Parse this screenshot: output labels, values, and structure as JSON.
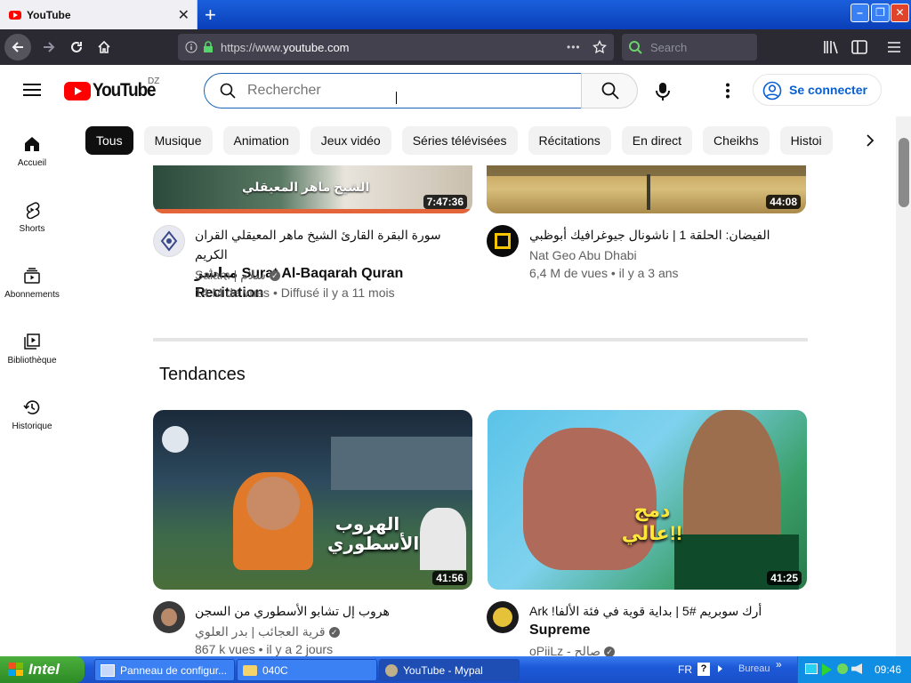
{
  "browser": {
    "tab_title": "YouTube",
    "tab_close": "✕",
    "new_tab": "+",
    "url_prefix": "https://www.",
    "url_host": "youtube.com",
    "url_more": "•••",
    "search_placeholder": "Search",
    "window_buttons": [
      "–",
      "❐",
      "✕"
    ]
  },
  "youtube": {
    "logo_text": "YouTube",
    "country_code": "DZ",
    "search_placeholder": "Rechercher",
    "signin_label": "Se connecter",
    "chips": [
      "Tous",
      "Musique",
      "Animation",
      "Jeux vidéo",
      "Séries télévisées",
      "Récitations",
      "En direct",
      "Cheikhs",
      "Histoi"
    ],
    "sidebar": [
      {
        "label": "Accueil",
        "icon": "home-icon"
      },
      {
        "label": "Shorts",
        "icon": "shorts-icon"
      },
      {
        "label": "Abonnements",
        "icon": "subscriptions-icon"
      },
      {
        "label": "Bibliothèque",
        "icon": "library-icon"
      },
      {
        "label": "Historique",
        "icon": "history-icon"
      }
    ],
    "videos_top": [
      {
        "thumb_text": "الشيخ ماهر المعيقلي",
        "duration": "7:47:36",
        "title_line1": "سورة البقرة القارئ الشيخ ماهر المعيقلي القران الكريم",
        "title_line2": "مباشر Surat Al-Baqarah Quran Recitation",
        "channel": "Salam | سلام",
        "meta": "14 M de vues • Diffusé il y a 11 mois"
      },
      {
        "duration": "44:08",
        "title_line1": "الفيضان: الحلقة 1 | ناشونال جيوغرافيك أبوظبي",
        "channel": "Nat Geo Abu Dhabi",
        "meta": "6,4 M de vues • il y a 3 ans"
      }
    ],
    "section_title": "Tendances",
    "videos_trending": [
      {
        "thumb_text": "الهروب الأسطوري",
        "duration": "41:56",
        "title_line1": "هروب إل تشابو الأسطوري من السجن",
        "channel": "قرية العجائب | بدر العلوي",
        "meta": "867 k vues • il y a 2 jours"
      },
      {
        "thumb_text": "دمج عالي!!",
        "duration": "41:25",
        "title_line1": "Ark !أرك سوبريم #5 | بداية قوية في فئة الألفا",
        "title_line2": "Supreme",
        "channel": "oPiiLz - صالح"
      }
    ]
  },
  "taskbar": {
    "start_label": "Intel",
    "tasks": [
      "Panneau de configur...",
      "040C",
      "YouTube - Mypal"
    ],
    "lang": "FR",
    "bureau_label": "Bureau",
    "clock": "09:46"
  },
  "colors": {
    "youtube_red": "#ff0000",
    "link_blue": "#065fd4",
    "firefox_dark": "#2b2a33",
    "xp_blue": "#1d5ad8"
  }
}
